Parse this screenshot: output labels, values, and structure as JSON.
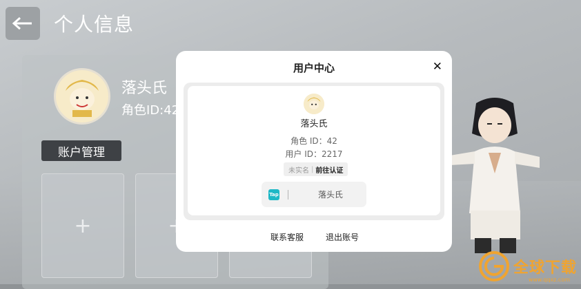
{
  "page": {
    "title": "个人信息"
  },
  "background_profile": {
    "name": "落头氏",
    "role_id": "角色ID:42",
    "account_tab": "账户管理",
    "slots": [
      "+",
      "+",
      "+"
    ]
  },
  "modal": {
    "title": "用户中心",
    "close": "✕",
    "card": {
      "name": "落头氏",
      "role_id": "角色 ID：42",
      "user_id": "用户 ID：2217",
      "verify_status": "未实名",
      "verify_separator": "|",
      "verify_action": "前往认证",
      "taptap_icon": "Tap",
      "taptap_name": "落头氏"
    },
    "links": {
      "support": "联系客服",
      "logout": "退出账号"
    }
  },
  "watermark": {
    "text": "全球下载",
    "sub": "www.qqxz.com"
  },
  "colors": {
    "accent": "#1fb8c6",
    "watermark": "#f0a430"
  }
}
